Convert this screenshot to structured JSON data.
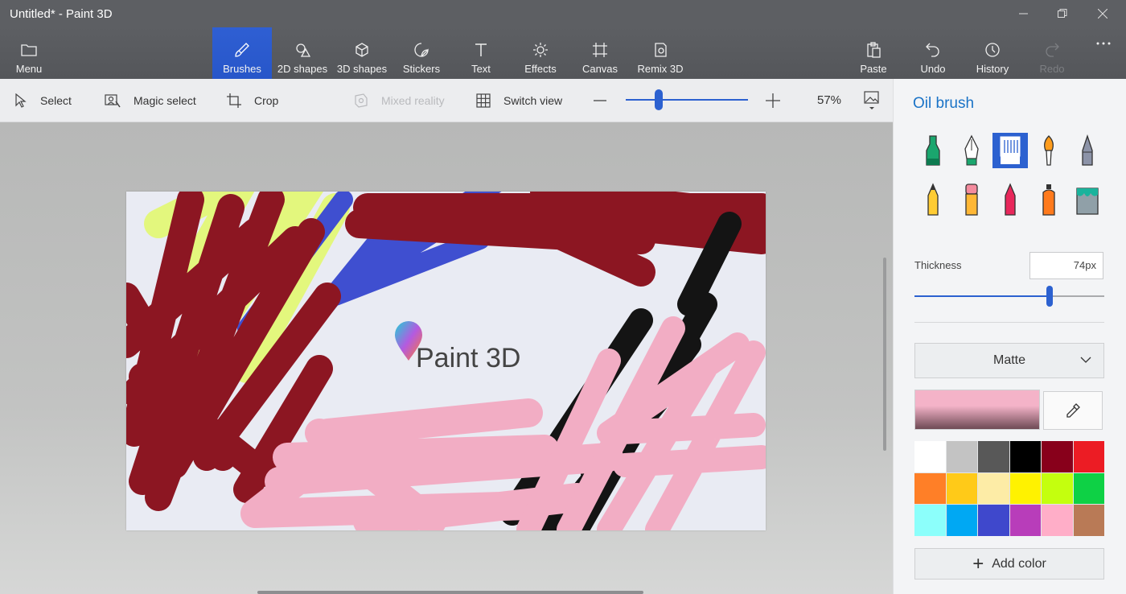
{
  "window": {
    "title": "Untitled* - Paint 3D"
  },
  "ribbon": {
    "menu": "Menu",
    "brushes": "Brushes",
    "shapes2d": "2D shapes",
    "shapes3d": "3D shapes",
    "stickers": "Stickers",
    "text": "Text",
    "effects": "Effects",
    "canvas": "Canvas",
    "remix": "Remix 3D",
    "paste": "Paste",
    "undo": "Undo",
    "history": "History",
    "redo": "Redo"
  },
  "toolbar": {
    "select": "Select",
    "magic_select": "Magic select",
    "crop": "Crop",
    "mixed_reality": "Mixed reality",
    "switch_view": "Switch view",
    "zoom_out": "—",
    "zoom_in": "+",
    "zoom_level": "57%",
    "zoom_fraction": 0.27
  },
  "canvas": {
    "logo_text": "Paint 3D"
  },
  "panel": {
    "title": "Oil brush",
    "brushes": [
      {
        "name": "marker",
        "selected": false
      },
      {
        "name": "calligraphy-pen",
        "selected": false
      },
      {
        "name": "oil-brush",
        "selected": true
      },
      {
        "name": "watercolor",
        "selected": false
      },
      {
        "name": "pixel-pen",
        "selected": false
      },
      {
        "name": "pencil",
        "selected": false
      },
      {
        "name": "eraser",
        "selected": false
      },
      {
        "name": "crayon",
        "selected": false
      },
      {
        "name": "spray-can",
        "selected": false
      },
      {
        "name": "fill",
        "selected": false
      }
    ],
    "thickness_label": "Thickness",
    "thickness_value": "74px",
    "thickness_fraction": 0.71,
    "finish": "Matte",
    "current_color": "#f4b3c8",
    "palette": [
      "#ffffff",
      "#c3c3c3",
      "#585858",
      "#000000",
      "#88001b",
      "#ec1c24",
      "#ff7f27",
      "#ffca18",
      "#fdeca6",
      "#fff200",
      "#c4ff0e",
      "#0ed145",
      "#8cfffb",
      "#00a8f3",
      "#3f48cc",
      "#b83dba",
      "#ffaec8",
      "#b97a56"
    ],
    "add_color": "Add color"
  },
  "colors": {
    "accent": "#2c61d0",
    "accent_text": "#1a73c7"
  }
}
